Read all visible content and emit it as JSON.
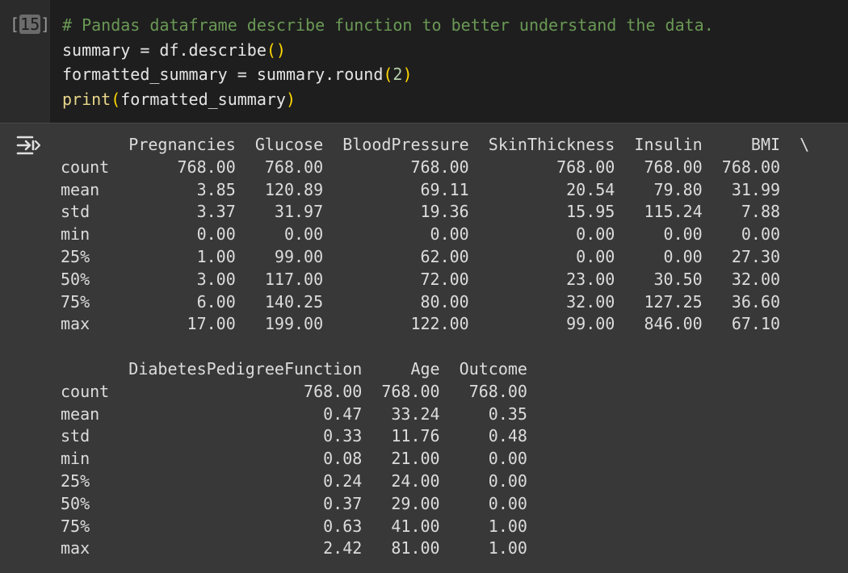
{
  "cell": {
    "execution_count": "15",
    "code": {
      "comment": "# Pandas dataframe describe function to better understand the data.",
      "line2": {
        "var": "summary",
        "op": " = ",
        "obj": "df.describe",
        "parens": "()"
      },
      "line3": {
        "var": "formatted_summary",
        "op": " = ",
        "obj": "summary.round",
        "open": "(",
        "arg": "2",
        "close": ")"
      },
      "line4": {
        "fn": "print",
        "open": "(",
        "arg": "formatted_summary",
        "close": ")"
      }
    }
  },
  "output": {
    "icon": "output-expand-icon",
    "table1": {
      "header": "       Pregnancies  Glucose  BloodPressure  SkinThickness  Insulin     BMI  \\",
      "rows": [
        "count       768.00   768.00         768.00         768.00   768.00  768.00",
        "mean          3.85   120.89          69.11          20.54    79.80   31.99",
        "std           3.37    31.97          19.36          15.95   115.24    7.88",
        "min           0.00     0.00           0.00           0.00     0.00    0.00",
        "25%           1.00    99.00          62.00           0.00     0.00   27.30",
        "50%           3.00   117.00          72.00          23.00    30.50   32.00",
        "75%           6.00   140.25          80.00          32.00   127.25   36.60",
        "max          17.00   199.00         122.00          99.00   846.00   67.10"
      ]
    },
    "table2": {
      "header": "       DiabetesPedigreeFunction     Age  Outcome",
      "rows": [
        "count                    768.00  768.00   768.00",
        "mean                       0.47   33.24     0.35",
        "std                        0.33   11.76     0.48",
        "min                        0.08   21.00     0.00",
        "25%                        0.24   24.00     0.00",
        "50%                        0.37   29.00     0.00",
        "75%                        0.63   41.00     1.00",
        "max                        2.42   81.00     1.00"
      ]
    }
  }
}
